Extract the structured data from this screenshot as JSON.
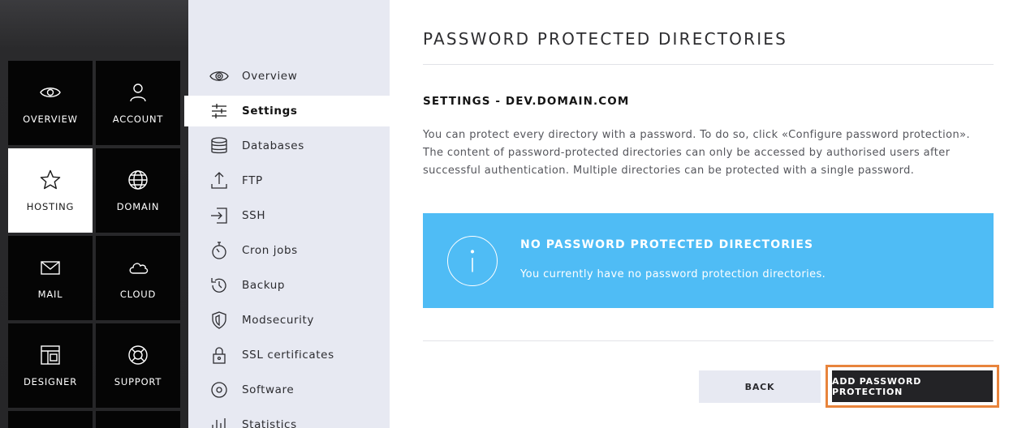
{
  "tiles": [
    {
      "label": "OVERVIEW",
      "icon": "eye-icon"
    },
    {
      "label": "ACCOUNT",
      "icon": "user-icon"
    },
    {
      "label": "HOSTING",
      "icon": "star-icon",
      "active": true
    },
    {
      "label": "DOMAIN",
      "icon": "globe-icon"
    },
    {
      "label": "MAIL",
      "icon": "envelope-icon"
    },
    {
      "label": "CLOUD",
      "icon": "cloud-icon"
    },
    {
      "label": "DESIGNER",
      "icon": "layout-icon"
    },
    {
      "label": "SUPPORT",
      "icon": "lifebuoy-icon"
    }
  ],
  "subnav": {
    "items": [
      {
        "label": "Overview",
        "icon": "eye-icon"
      },
      {
        "label": "Settings",
        "icon": "sliders-icon",
        "active": true
      },
      {
        "label": "Databases",
        "icon": "database-icon"
      },
      {
        "label": "FTP",
        "icon": "upload-icon"
      },
      {
        "label": "SSH",
        "icon": "login-icon"
      },
      {
        "label": "Cron jobs",
        "icon": "stopwatch-icon"
      },
      {
        "label": "Backup",
        "icon": "history-icon"
      },
      {
        "label": "Modsecurity",
        "icon": "shield-icon"
      },
      {
        "label": "SSL certificates",
        "icon": "lock-icon"
      },
      {
        "label": "Software",
        "icon": "disc-icon"
      },
      {
        "label": "Statistics",
        "icon": "bar-chart-icon"
      }
    ]
  },
  "main": {
    "title": "PASSWORD PROTECTED DIRECTORIES",
    "section_title": "SETTINGS - DEV.DOMAIN.COM",
    "description": "You can protect every directory with a password. To do so, click «Configure password protection». The content of password-protected directories can only be accessed by authorised users after successful authentication. Multiple directories can be protected with a single password.",
    "info": {
      "title": "NO PASSWORD PROTECTED DIRECTORIES",
      "text": "You currently have no password protection directories.",
      "icon": "info-icon"
    },
    "buttons": {
      "back": "BACK",
      "add": "ADD PASSWORD PROTECTION"
    }
  },
  "colors": {
    "info_box": "#4fbcf5",
    "highlight_border": "#e8843c",
    "primary_button": "#232326",
    "subnav_bg": "#e7e9f2"
  }
}
